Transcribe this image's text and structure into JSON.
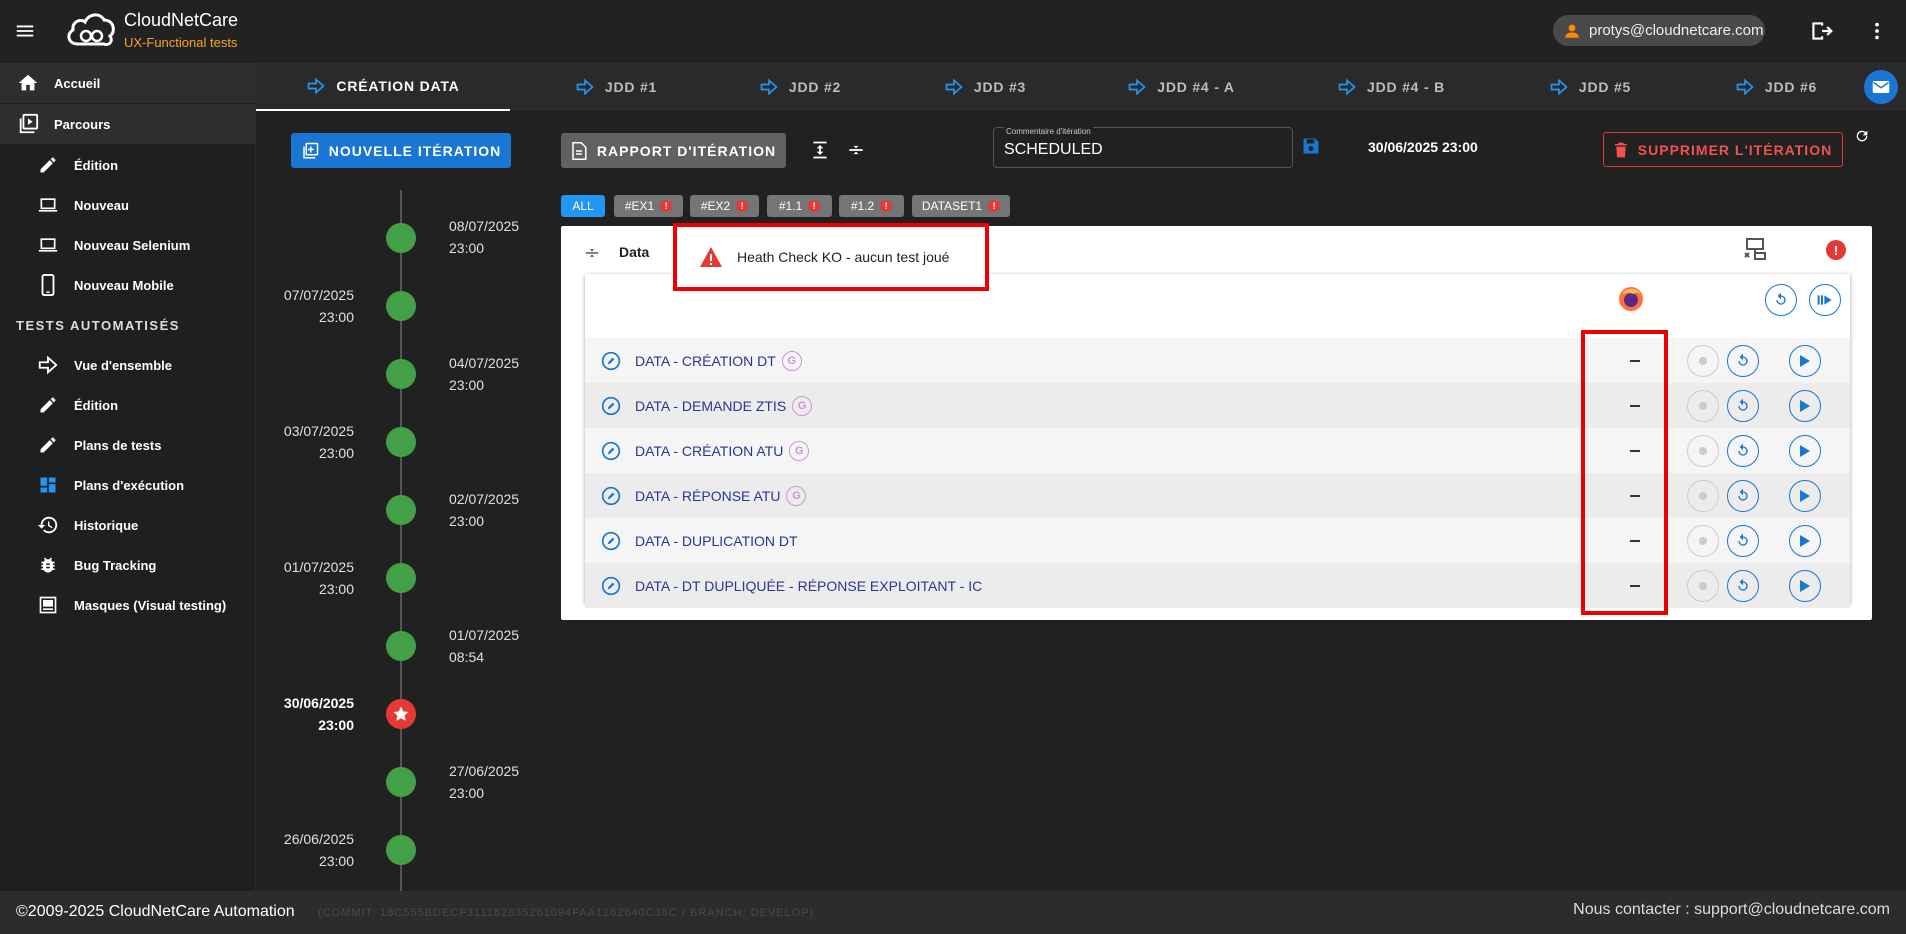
{
  "header": {
    "brand_name": "CloudNetCare",
    "brand_sub": "UX-Functional tests",
    "user_email": "protys@cloudnetcare.com"
  },
  "sidebar": {
    "top_items": [
      {
        "label": "Accueil",
        "icon": "home-icon"
      },
      {
        "label": "Parcours",
        "icon": "library-play-icon"
      }
    ],
    "parcours_items": [
      {
        "label": "Édition",
        "icon": "pencil-icon"
      },
      {
        "label": "Nouveau",
        "icon": "laptop-icon"
      },
      {
        "label": "Nouveau Selenium",
        "icon": "laptop-icon"
      },
      {
        "label": "Nouveau Mobile",
        "icon": "phone-icon"
      }
    ],
    "section_label": "TESTS AUTOMATISÉS",
    "auto_items": [
      {
        "label": "Vue d'ensemble",
        "icon": "arrow-right-icon"
      },
      {
        "label": "Édition",
        "icon": "pencil-icon"
      },
      {
        "label": "Plans de tests",
        "icon": "pencil-icon"
      },
      {
        "label": "Plans d'exécution",
        "icon": "dashboard-icon"
      },
      {
        "label": "Historique",
        "icon": "history-icon"
      },
      {
        "label": "Bug Tracking",
        "icon": "bug-icon"
      },
      {
        "label": "Masques (Visual testing)",
        "icon": "mask-icon"
      }
    ]
  },
  "tabs": [
    {
      "label": "CRÉATION DATA",
      "active": true
    },
    {
      "label": "JDD #1"
    },
    {
      "label": "JDD #2"
    },
    {
      "label": "JDD #3"
    },
    {
      "label": "JDD #4 - A"
    },
    {
      "label": "JDD #4 - B"
    },
    {
      "label": "JDD #5"
    },
    {
      "label": "JDD #6"
    }
  ],
  "toolbar": {
    "new_iteration": "NOUVELLE ITÉRATION",
    "report": "RAPPORT D'ITÉRATION",
    "comment_label": "Commentaire d'itération",
    "comment_value": "SCHEDULED",
    "date": "30/06/2025 23:00",
    "delete": "SUPPRIMER L'ITÉRATION"
  },
  "filters": [
    {
      "label": "ALL",
      "active": true,
      "alert": false
    },
    {
      "label": "#EX1",
      "alert": true
    },
    {
      "label": "#EX2",
      "alert": true
    },
    {
      "label": "#1.1",
      "alert": true
    },
    {
      "label": "#1.2",
      "alert": true
    },
    {
      "label": "DATASET1",
      "alert": true
    }
  ],
  "timeline": [
    {
      "date": "08/07/2025",
      "time": "23:00",
      "side": "right"
    },
    {
      "date": "07/07/2025",
      "time": "23:00",
      "side": "left"
    },
    {
      "date": "04/07/2025",
      "time": "23:00",
      "side": "right"
    },
    {
      "date": "03/07/2025",
      "time": "23:00",
      "side": "left"
    },
    {
      "date": "02/07/2025",
      "time": "23:00",
      "side": "right"
    },
    {
      "date": "01/07/2025",
      "time": "23:00",
      "side": "left"
    },
    {
      "date": "01/07/2025",
      "time": "08:54",
      "side": "right"
    },
    {
      "date": "30/06/2025",
      "time": "23:00",
      "side": "left",
      "current": true
    },
    {
      "date": "27/06/2025",
      "time": "23:00",
      "side": "right"
    },
    {
      "date": "26/06/2025",
      "time": "23:00",
      "side": "left"
    }
  ],
  "panel": {
    "title": "Data",
    "alert_text": "Heath Check KO - aucun test joué",
    "rows": [
      {
        "name": "DATA - CRÉATION DT",
        "g": true,
        "status": "–"
      },
      {
        "name": "DATA - DEMANDE ZTIS",
        "g": true,
        "status": "–"
      },
      {
        "name": "DATA - CRÉATION ATU",
        "g": true,
        "status": "–"
      },
      {
        "name": "DATA - RÉPONSE ATU",
        "g": true,
        "status": "–"
      },
      {
        "name": "DATA - DUPLICATION DT",
        "g": false,
        "status": "–"
      },
      {
        "name": "DATA - DT DUPLIQUÉE - RÉPONSE EXPLOITANT - IC",
        "g": false,
        "status": "–"
      }
    ]
  },
  "footer": {
    "copyright": "©2009-2025 CloudNetCare Automation",
    "commit": "(COMMIT: 18C555BDECF311162835261094FAA1262640C38C / BRANCH: DEVELOP)",
    "contact": "Nous contacter : support@cloudnetcare.com"
  },
  "colors": {
    "accent": "#1976d2",
    "success": "#43a047",
    "danger": "#e53935",
    "brand_sub": "#f5a623"
  }
}
